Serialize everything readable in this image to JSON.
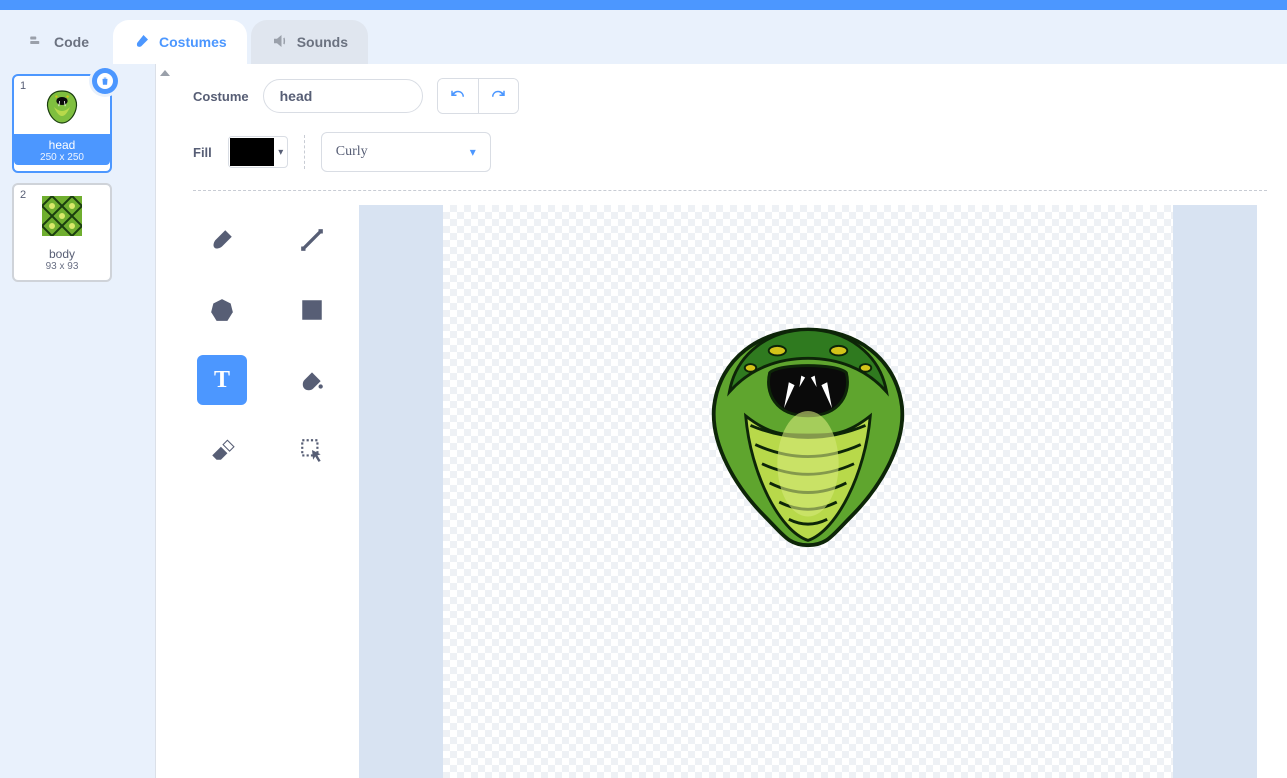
{
  "tabs": {
    "code": "Code",
    "costumes": "Costumes",
    "sounds": "Sounds"
  },
  "costume_label": "Costume",
  "costume_name": "head",
  "fill_label": "Fill",
  "fill_color": "#000000",
  "font_name": "Curly",
  "costumes": [
    {
      "index": "1",
      "name": "head",
      "dims": "250 x 250",
      "selected": true
    },
    {
      "index": "2",
      "name": "body",
      "dims": "93 x 93",
      "selected": false
    }
  ],
  "tools": [
    {
      "id": "brush",
      "selected": false
    },
    {
      "id": "line",
      "selected": false
    },
    {
      "id": "circle",
      "selected": false
    },
    {
      "id": "square",
      "selected": false
    },
    {
      "id": "text",
      "selected": true
    },
    {
      "id": "fill",
      "selected": false
    },
    {
      "id": "eraser",
      "selected": false
    },
    {
      "id": "select",
      "selected": false
    }
  ]
}
